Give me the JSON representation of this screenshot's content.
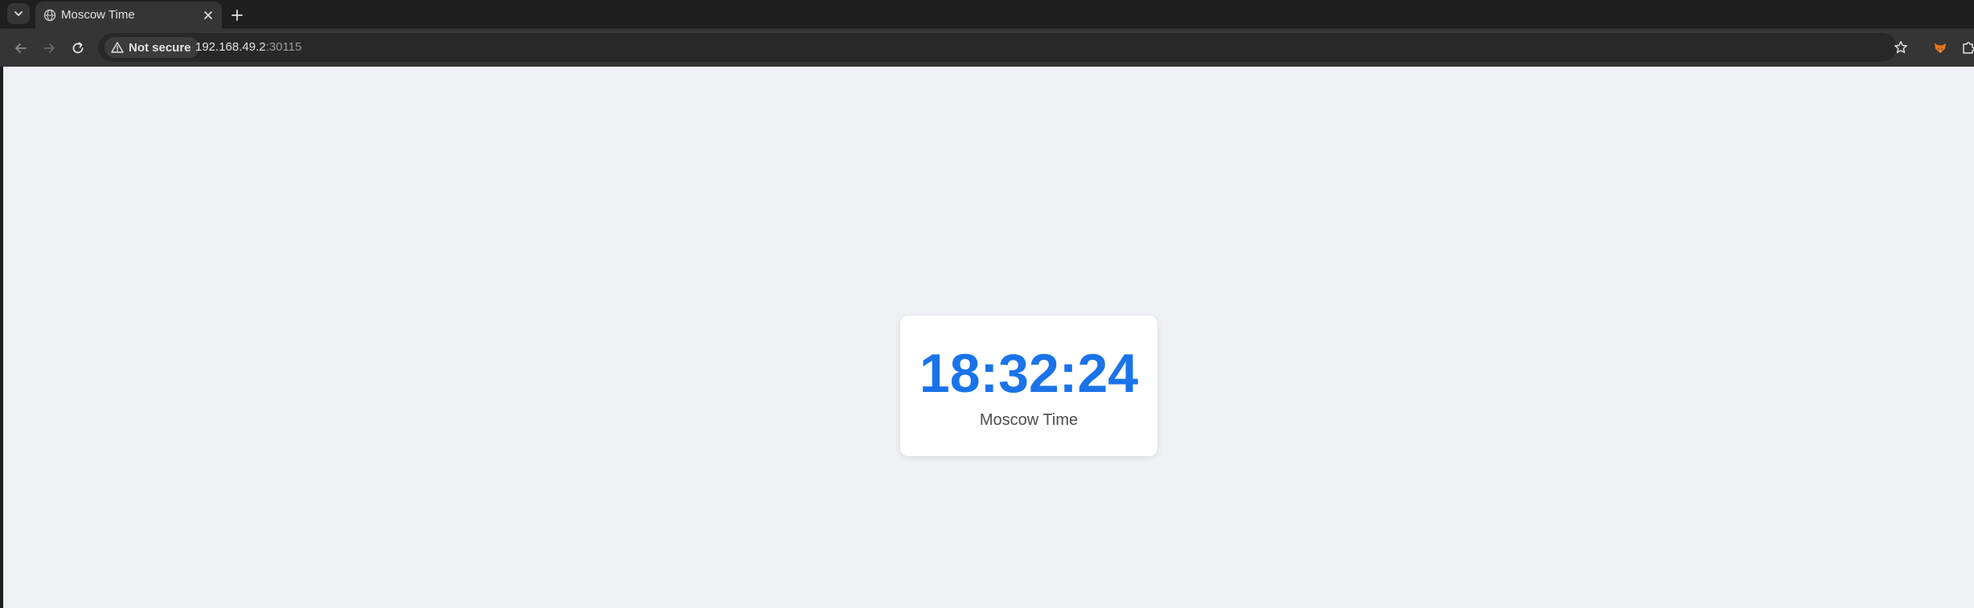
{
  "browser": {
    "tab": {
      "title": "Moscow Time",
      "favicon": "globe-icon"
    },
    "toolbar": {
      "security_label": "Not secure",
      "url_host": "192.168.49.2",
      "url_port": ":30115"
    },
    "colors": {
      "chrome_dark": "#1f1f1f",
      "toolbar": "#353535",
      "page_background": "#eff1f5"
    }
  },
  "page": {
    "time": "18:32:24",
    "label": "Moscow Time",
    "time_color": "#1a73e8",
    "label_color": "#4d4d4d"
  }
}
